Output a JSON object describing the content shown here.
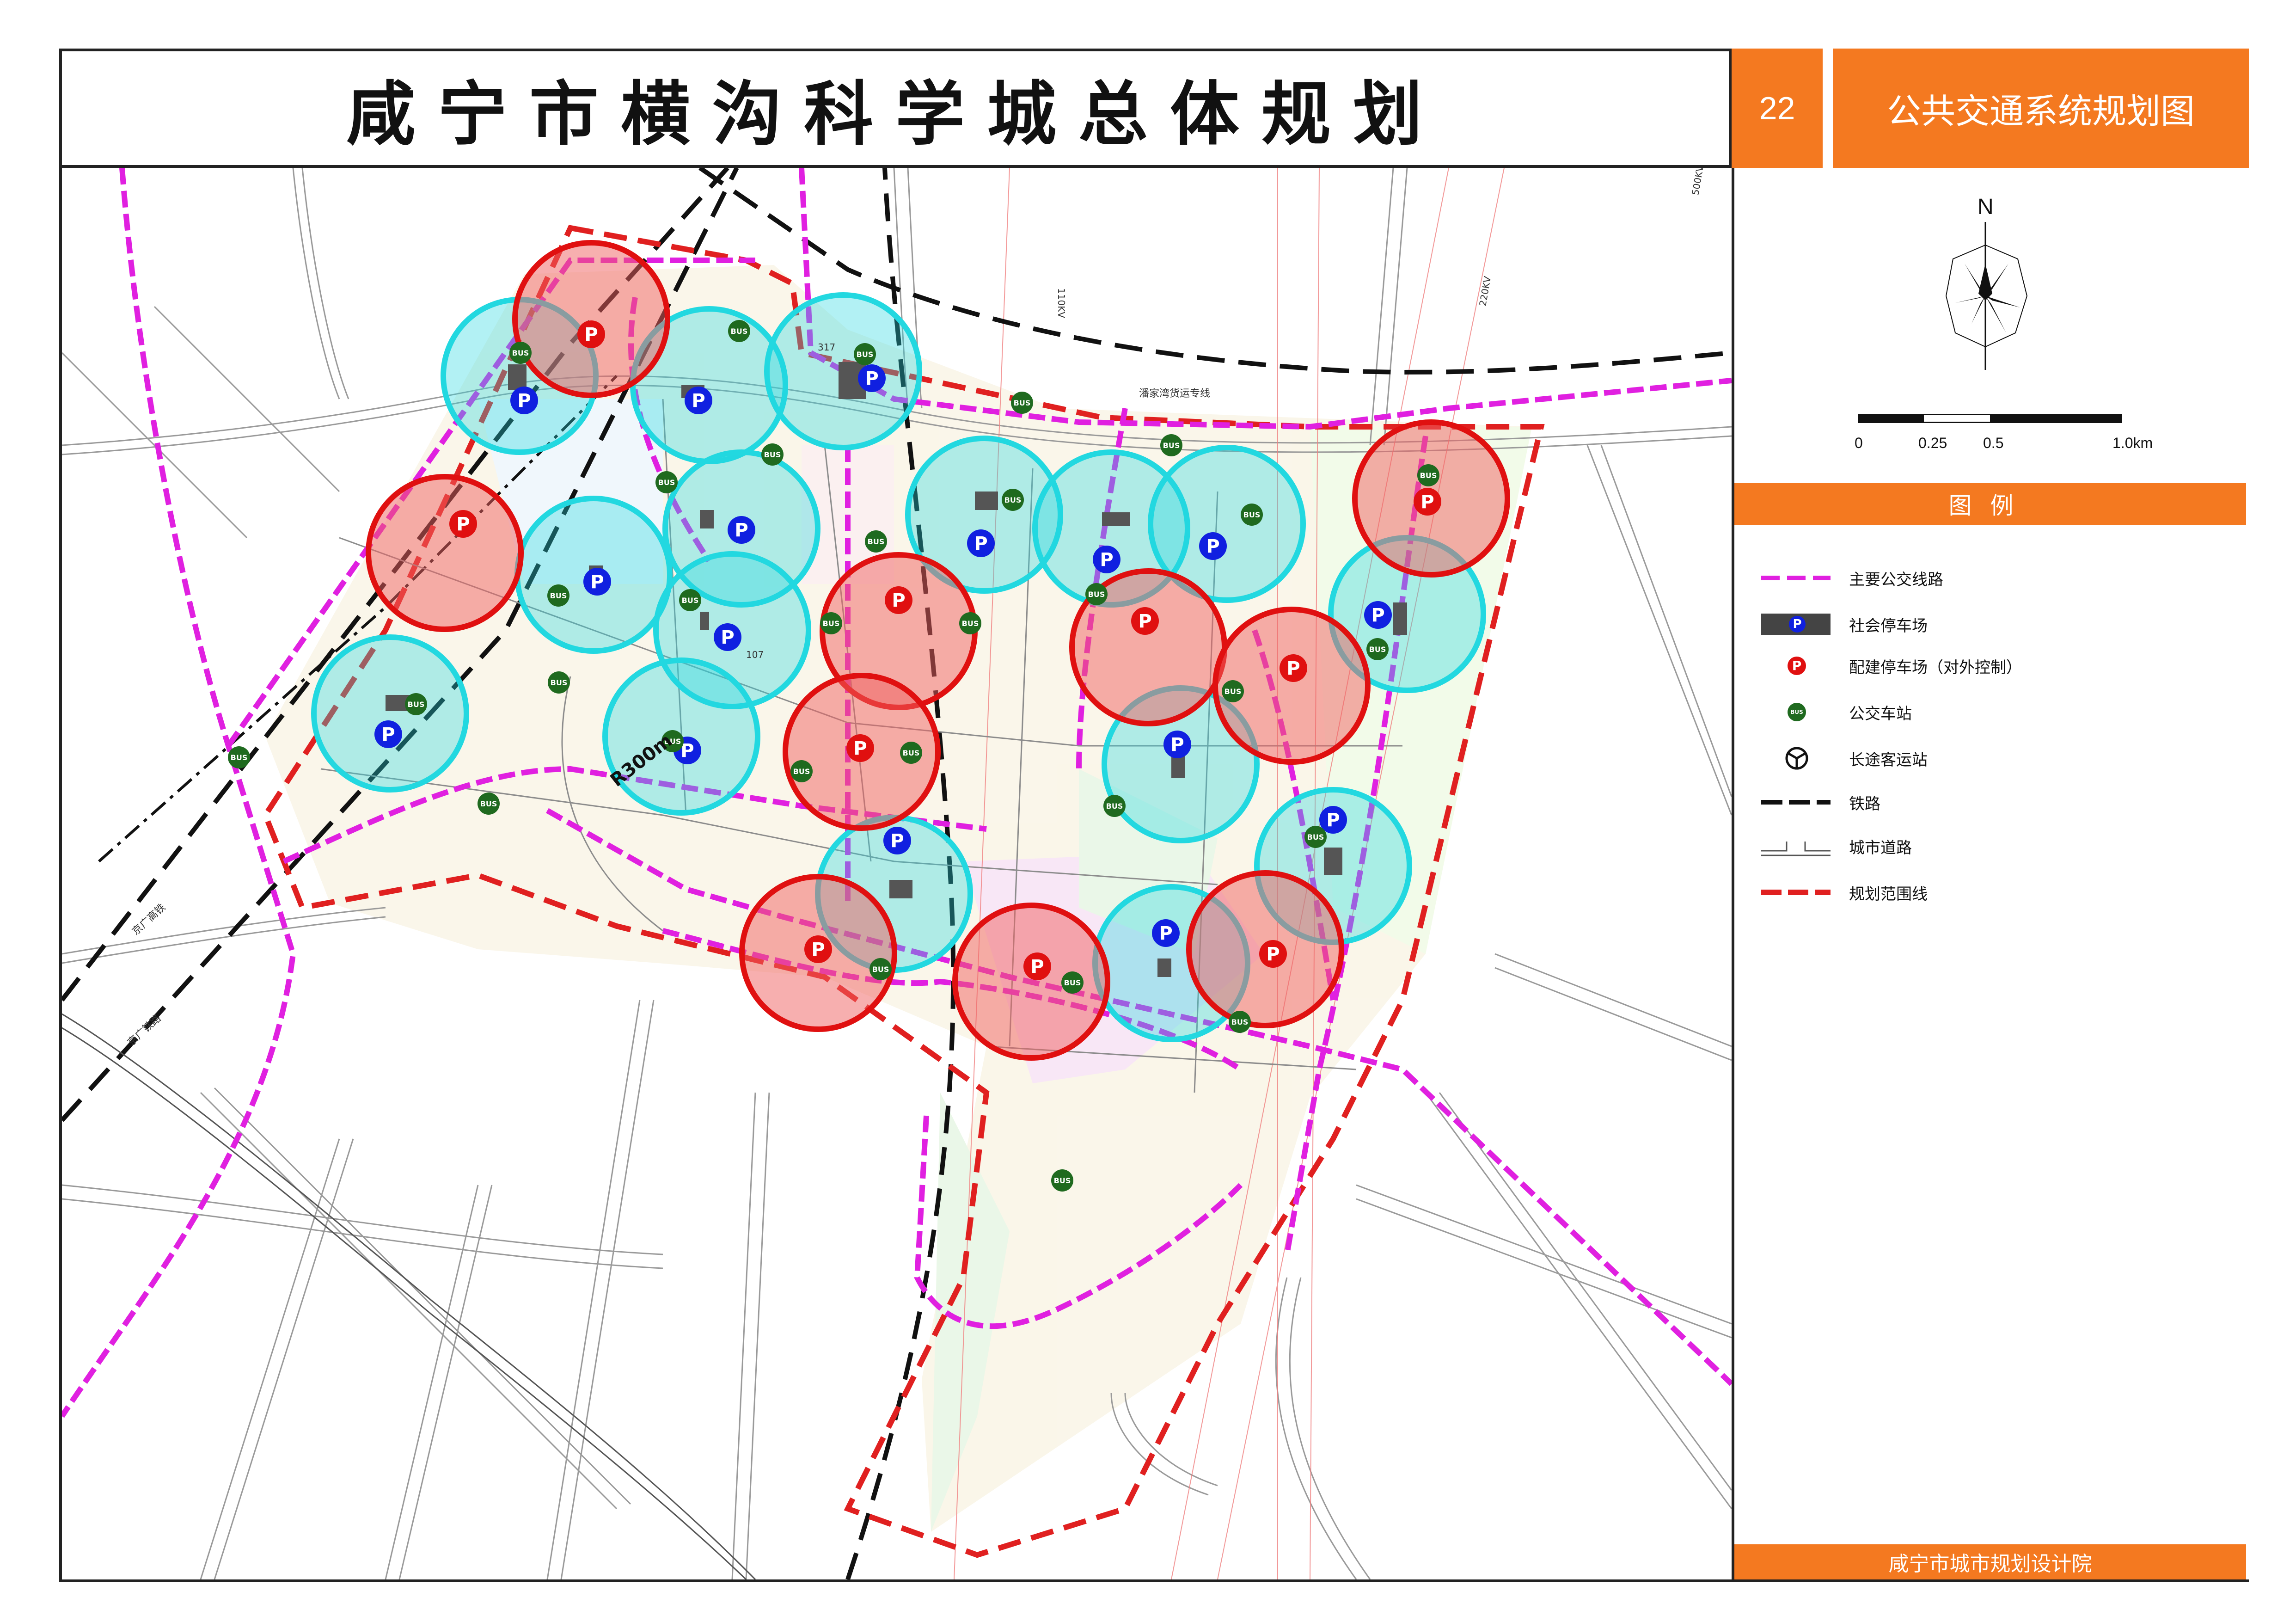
{
  "header": {
    "title": "咸宁市横沟科学城总体规划",
    "page_number": "22",
    "sheet_title": "公共交通系统规划图"
  },
  "compass": {
    "north_label": "N"
  },
  "scale_bar": {
    "labels": [
      "0",
      "0.25",
      "0.5",
      "1.0km"
    ]
  },
  "legend": {
    "title": "图例",
    "items": [
      {
        "label": "主要公交线路",
        "icon": "bus-route-line"
      },
      {
        "label": "社会停车场",
        "icon": "public-parking-icon"
      },
      {
        "label": "配建停车场（对外控制）",
        "icon": "attached-parking-icon"
      },
      {
        "label": "公交车站",
        "icon": "bus-stop-icon"
      },
      {
        "label": "长途客运站",
        "icon": "coach-station-icon"
      },
      {
        "label": "铁路",
        "icon": "railway-line"
      },
      {
        "label": "城市道路",
        "icon": "city-road-line"
      },
      {
        "label": "规划范围线",
        "icon": "planning-boundary-line"
      }
    ]
  },
  "footer": {
    "institute": "咸宁市城市规划设计院"
  },
  "map": {
    "radius_label": "R300m",
    "parking_symbol": "P",
    "bus_symbol": "BUS",
    "road_labels": [
      "317",
      "107",
      "110KV",
      "220KV",
      "500KV",
      "潘家湾货运专线",
      "京广高铁",
      "京广铁路"
    ],
    "colors": {
      "bus_route": "#e020e0",
      "public_parking_ring": "#22d8e0",
      "attached_parking_ring": "#e01010",
      "boundary": "#e02020",
      "railway": "#111111",
      "accent": "#f47920"
    }
  }
}
